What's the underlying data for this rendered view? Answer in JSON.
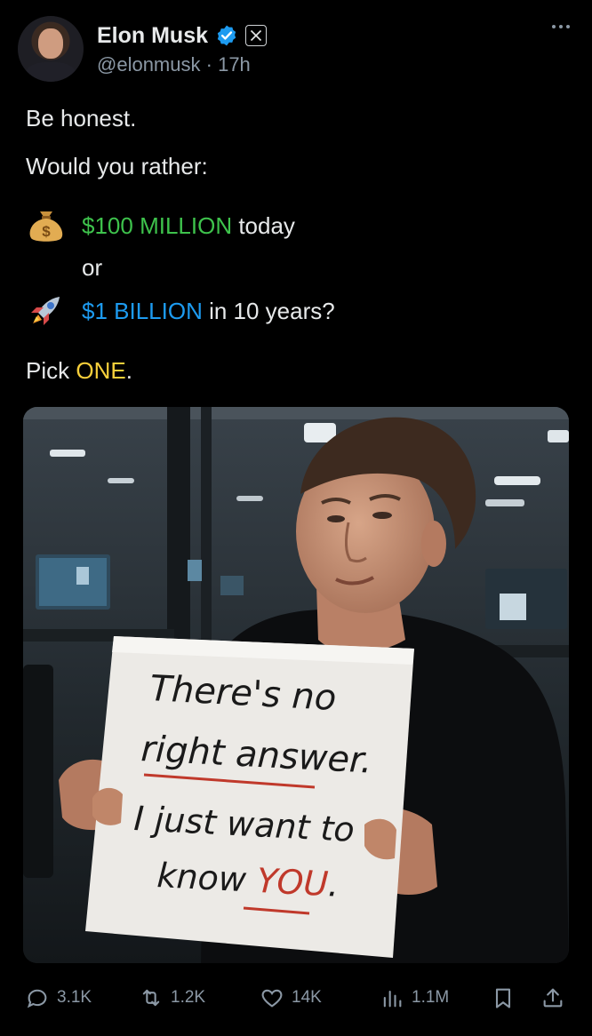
{
  "author": {
    "name": "Elon Musk",
    "handle": "@elonmusk",
    "separator": "·",
    "time": "17h",
    "verified_color": "#1d9bf0"
  },
  "tweet": {
    "line1": "Be honest.",
    "line2": "Would you rather:",
    "option1": {
      "highlight": "$100 MILLION",
      "rest": " today",
      "emoji": "money-bag-icon",
      "color": "#3ec24c"
    },
    "or": "or",
    "option2": {
      "highlight": "$1 BILLION",
      "rest": " in 10 years?",
      "emoji": "rocket-icon",
      "color": "#1d9bf0"
    },
    "pick_prefix": "Pick ",
    "pick_highlight": "ONE",
    "pick_suffix": ".",
    "pick_color": "#f7cf3b"
  },
  "media": {
    "sign_line1": "There's no",
    "sign_line2": "right answer.",
    "sign_line3": "I just want to",
    "sign_line4_prefix": "know ",
    "sign_line4_highlight": "YOU",
    "sign_line4_suffix": "."
  },
  "actions": {
    "replies": "3.1K",
    "reposts": "1.2K",
    "likes": "14K",
    "views": "1.1M"
  }
}
